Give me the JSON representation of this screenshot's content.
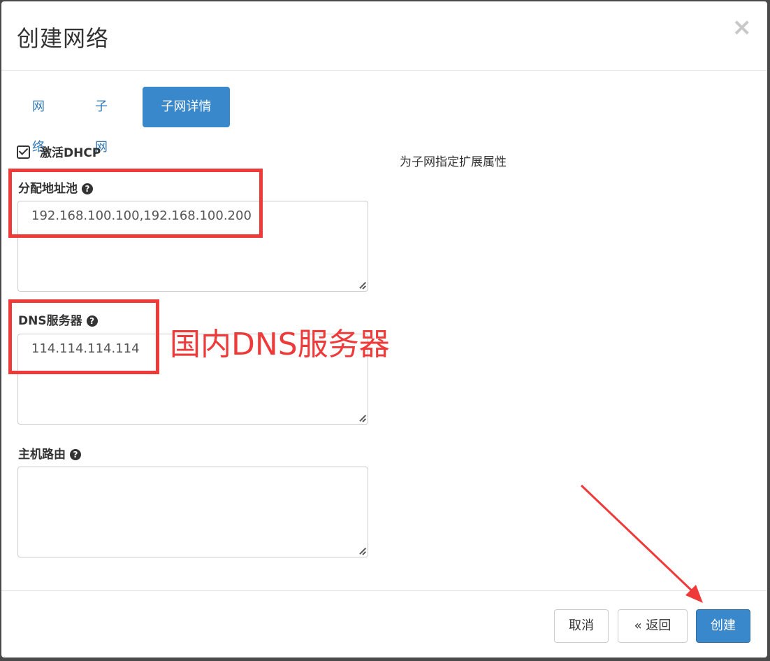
{
  "modal": {
    "title": "创建网络",
    "close_label": "×"
  },
  "tabs": [
    {
      "label": "网络"
    },
    {
      "label": "子网"
    },
    {
      "label": "子网详情",
      "active": true
    }
  ],
  "dhcp": {
    "label": "激活DHCP",
    "checked": true
  },
  "help_text": "为子网指定扩展属性",
  "fields": {
    "allocation_pools": {
      "label": "分配地址池",
      "value": "192.168.100.100,192.168.100.200"
    },
    "dns_servers": {
      "label": "DNS服务器",
      "value": "114.114.114.114"
    },
    "host_routes": {
      "label": "主机路由",
      "value": ""
    }
  },
  "help_icon": "?",
  "annotation": {
    "text": "国内DNS服务器",
    "color": "#ef3a3a"
  },
  "footer": {
    "cancel_label": "取消",
    "back_label": "« 返回",
    "create_label": "创建"
  },
  "colors": {
    "primary": "#3a88cc",
    "link": "#337ab7",
    "annotation_red": "#ef3a3a"
  }
}
